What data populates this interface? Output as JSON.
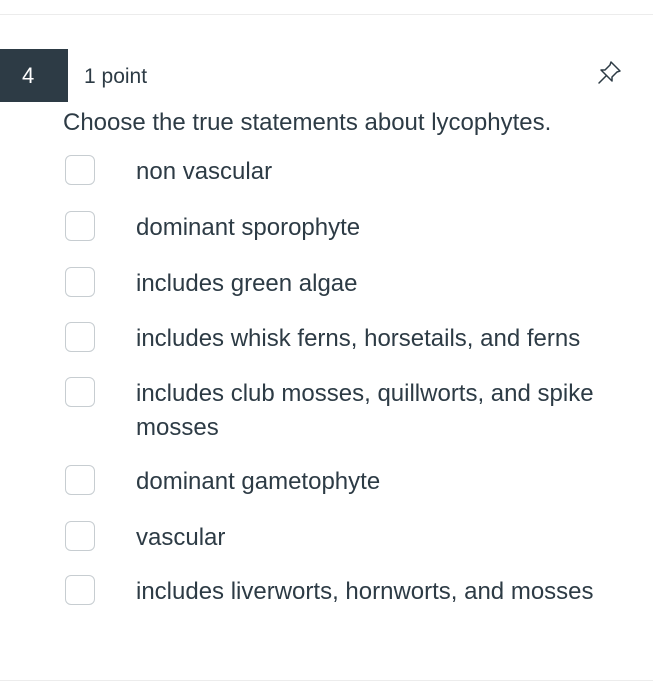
{
  "question": {
    "number": "4",
    "points": "1 point",
    "text": "Choose the true statements about lycophytes.",
    "pin_icon": "pin-icon"
  },
  "answers": [
    {
      "label": "non vascular",
      "checked": false
    },
    {
      "label": "dominant sporophyte",
      "checked": false
    },
    {
      "label": "includes green algae",
      "checked": false
    },
    {
      "label": "includes whisk ferns, horsetails, and ferns",
      "checked": false
    },
    {
      "label": "includes club mosses, quillworts, and spike mosses",
      "checked": false
    },
    {
      "label": "dominant gametophyte",
      "checked": false
    },
    {
      "label": "vascular",
      "checked": false
    },
    {
      "label": "includes liverworts, hornworts, and mosses",
      "checked": false
    }
  ],
  "colors": {
    "number_badge_bg": "#2d3b45",
    "text": "#2d3b45",
    "checkbox_border": "#c7cdd1"
  }
}
